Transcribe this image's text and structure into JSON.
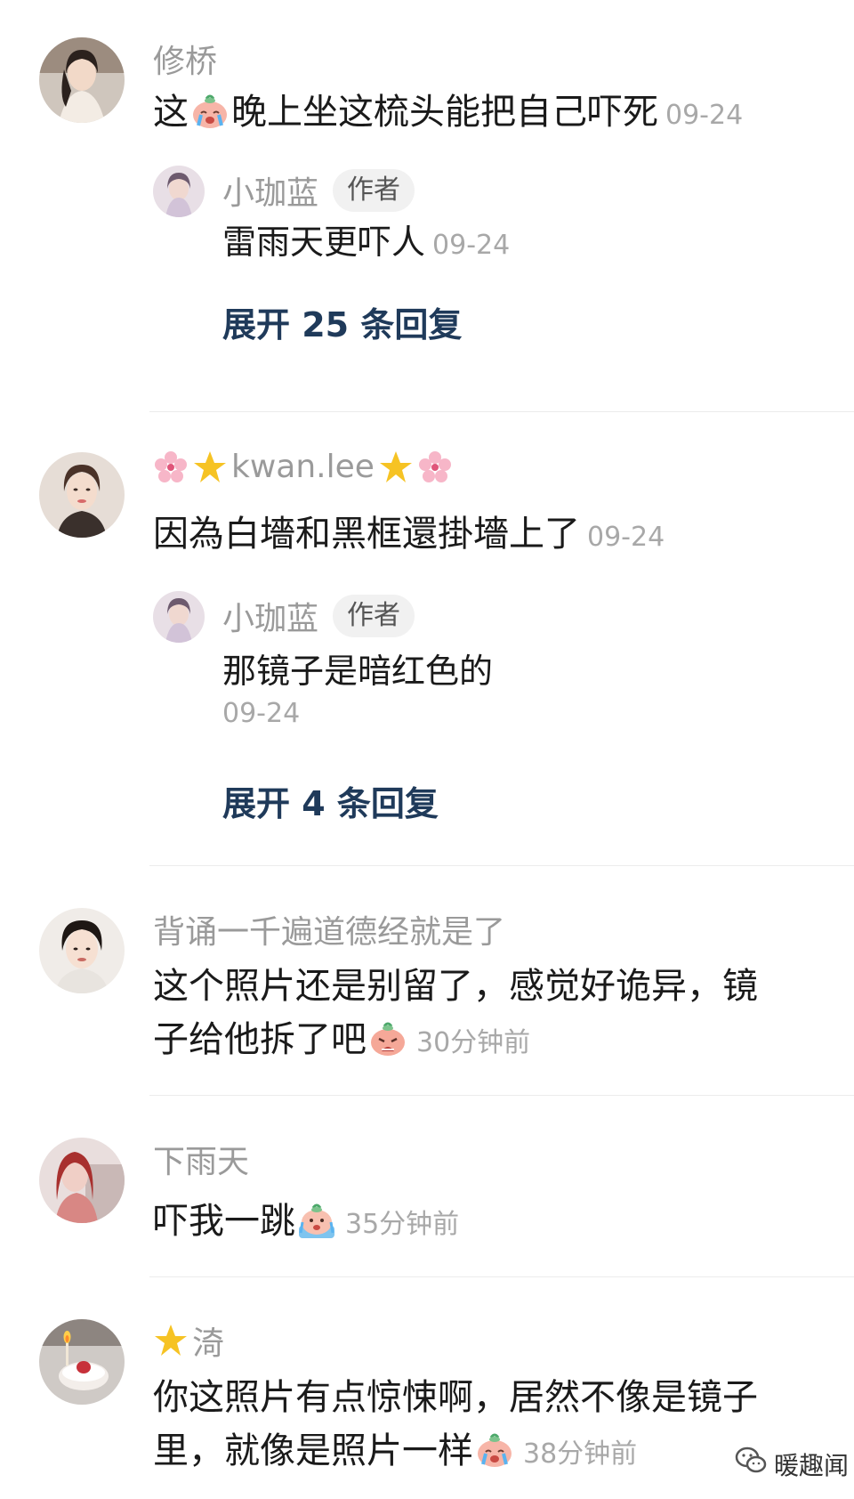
{
  "comments": [
    {
      "user": "修桥",
      "text_a": "这",
      "text_b": "晚上坐这梳头能把自己吓死",
      "time": "09-24",
      "reply": {
        "user": "小珈蓝",
        "badge": "作者",
        "text": "雷雨天更吓人",
        "time": "09-24"
      },
      "expand": "展开 25 条回复"
    },
    {
      "user": "kwan.lee",
      "text": "因為白墻和黑框還掛墻上了",
      "time": "09-24",
      "reply": {
        "user": "小珈蓝",
        "badge": "作者",
        "text": "那镜子是暗红色的",
        "time": "09-24"
      },
      "expand": "展开 4 条回复"
    },
    {
      "user": "背诵一千遍道德经就是了",
      "text_line1": "这个照片还是别留了，感觉好诡异，镜",
      "text_line2": "子给他拆了吧",
      "time": "30分钟前"
    },
    {
      "user": "下雨天",
      "text": "吓我一跳",
      "time": "35分钟前"
    },
    {
      "user": "渏",
      "text_line1": "你这照片有点惊悚啊，居然不像是镜子",
      "text_line2": "里，就像是照片一样",
      "time": "38分钟前"
    }
  ],
  "watermark": "暖趣闻",
  "icons": {
    "emoji_cry": "crying-face-emoji",
    "emoji_sob": "sobbing-face-emoji",
    "emoji_scared": "scared-face-emoji",
    "flower": "cherry-blossom-icon",
    "star": "glowing-star-icon",
    "wechat": "wechat-logo-icon"
  }
}
